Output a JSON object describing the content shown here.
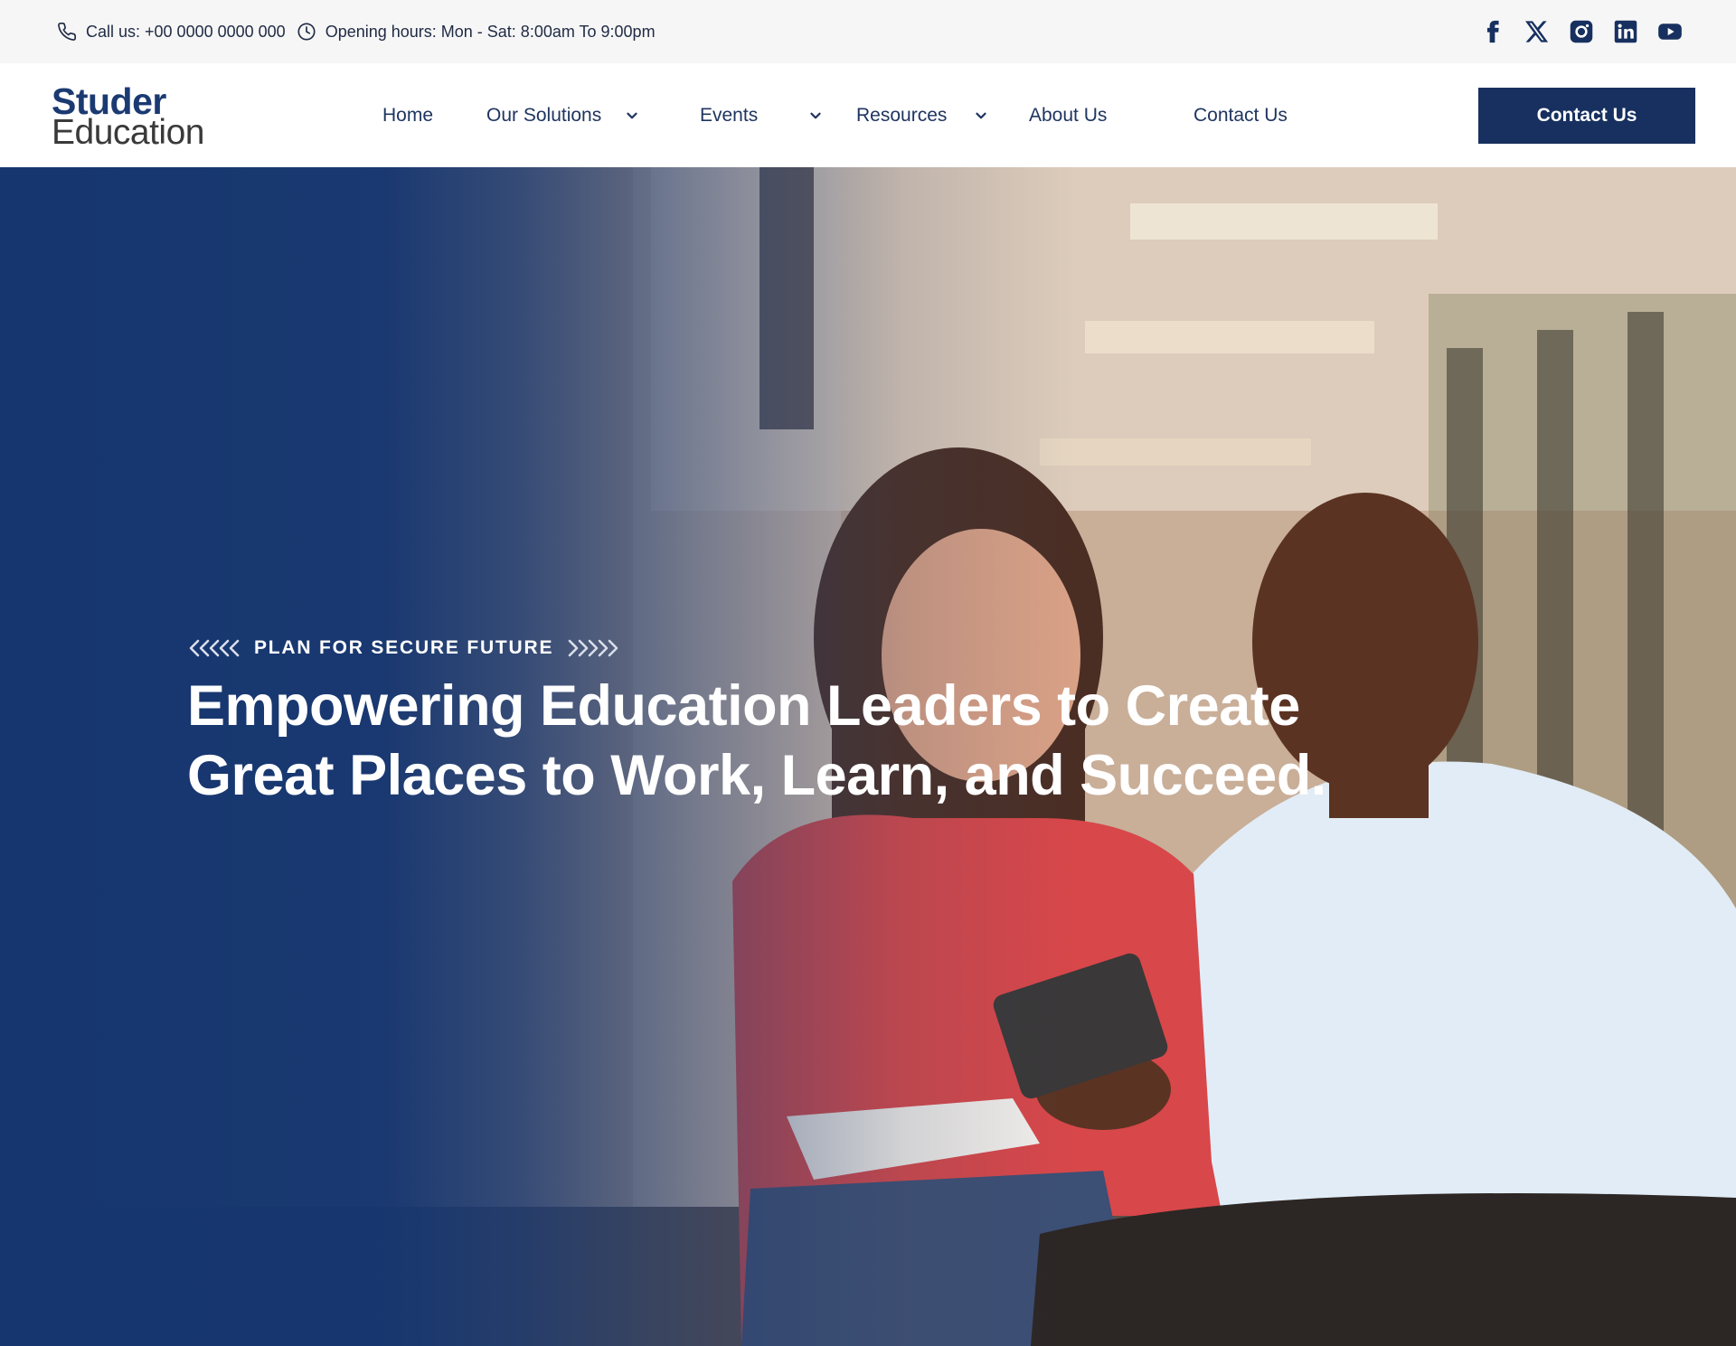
{
  "topbar": {
    "phone_text": "Call us: +00 0000 0000 000",
    "hours_text": "Opening hours: Mon - Sat: 8:00am To 9:00pm",
    "social": [
      "facebook-icon",
      "x-twitter-icon",
      "instagram-icon",
      "linkedin-icon",
      "youtube-icon"
    ]
  },
  "header": {
    "logo_line1": "Studer",
    "logo_line2": "Education",
    "nav": {
      "home": "Home",
      "solutions": "Our Solutions",
      "events": "Events",
      "resources": "Resources",
      "about": "About Us",
      "contact": "Contact Us"
    },
    "cta_label": "Contact Us"
  },
  "hero": {
    "eyebrow": "PLAN FOR SECURE FUTURE",
    "headline": "Empowering Education Leaders to Create Great Places to Work, Learn, and Succeed."
  },
  "colors": {
    "brand_navy": "#17305f",
    "hero_overlay": "#163670",
    "topbar_bg": "#f6f6f6"
  }
}
